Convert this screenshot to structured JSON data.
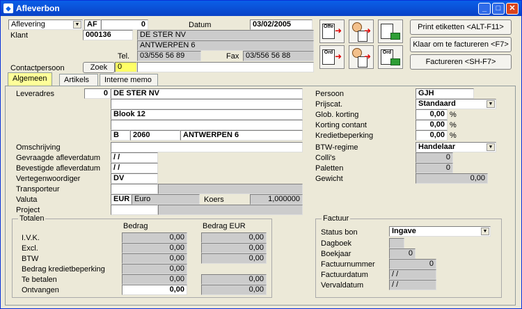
{
  "window": {
    "title": "Afleverbon",
    "minimize": "_",
    "maximize": "□",
    "close": "✕"
  },
  "header": {
    "doc_type": "Aflevering",
    "code": "AF",
    "number": "0",
    "date_label": "Datum",
    "date": "03/02/2005",
    "klant_label": "Klant",
    "klant_nr": "000136",
    "klant_name": "DE STER NV",
    "klant_city": "ANTWERPEN 6",
    "tel_label": "Tel.",
    "tel": "03/556 56 89",
    "fax_label": "Fax",
    "fax": "03/556 56 88",
    "contact_label": "Contactpersoon",
    "zoek_label": "Zoek",
    "contact_value": "0"
  },
  "icon_buttons": [
    {
      "text": "Offe"
    },
    {
      "text": "Ord"
    },
    {
      "text": "Ord"
    }
  ],
  "actions": {
    "print": "Print etiketten <ALT-F11>",
    "klaar": "Klaar om te factureren <F7>",
    "factureren": "Factureren <SH-F7>"
  },
  "tabs": [
    "Algemeen",
    "Artikels",
    "Interne memo"
  ],
  "left": {
    "leveradres_label": "Leveradres",
    "leveradres_nr": "0",
    "leveradres_name": "DE STER NV",
    "address_line3": "Blook 12",
    "country": "B",
    "postcode": "2060",
    "city": "ANTWERPEN 6",
    "omschrijving_label": "Omschrijving",
    "gevraagde_label": "Gevraagde afleverdatum",
    "gevraagde": " /  /",
    "bevestigde_label": "Bevestigde afleverdatum",
    "bevestigde": " /  /",
    "vertegen_label": "Vertegenwoordiger",
    "vertegen": "DV",
    "transporteur_label": "Transporteur",
    "valuta_label": "Valuta",
    "valuta_code": "EUR",
    "valuta_name": "Euro",
    "koers_label": "Koers",
    "koers": "1,000000",
    "project_label": "Project"
  },
  "right": {
    "persoon_label": "Persoon",
    "persoon": "GJH",
    "prijscat_label": "Prijscat.",
    "prijscat": "Standaard",
    "glob_label": "Glob. korting",
    "glob": "0,00",
    "kortcont_label": "Korting contant",
    "kortcont": "0,00",
    "kredietbep_label": "Kredietbeperking",
    "kredietbep": "0,00",
    "pct": "%",
    "btw_label": "BTW-regime",
    "btw": "Handelaar",
    "collis_label": "Colli's",
    "collis": "0",
    "paletten_label": "Paletten",
    "paletten": "0",
    "gewicht_label": "Gewicht",
    "gewicht": "0,00"
  },
  "totalen": {
    "title": "Totalen",
    "col1": "Bedrag",
    "col2": "Bedrag EUR",
    "rows": [
      {
        "label": "I.V.K.",
        "v1": "0,00",
        "v2": "0,00"
      },
      {
        "label": "Excl.",
        "v1": "0,00",
        "v2": "0,00"
      },
      {
        "label": "BTW",
        "v1": "0,00",
        "v2": "0,00"
      },
      {
        "label": "Bedrag kredietbeperking",
        "v1": "0,00",
        "v2": ""
      },
      {
        "label": "Te betalen",
        "v1": "0,00",
        "v2": "0,00"
      },
      {
        "label": "Ontvangen",
        "v1": "0,00",
        "v2": "0,00"
      }
    ]
  },
  "factuur": {
    "title": "Factuur",
    "status_label": "Status bon",
    "status": "Ingave",
    "dagboek_label": "Dagboek",
    "dagboek": "",
    "boekjaar_label": "Boekjaar",
    "boekjaar": "0",
    "factuurnr_label": "Factuurnummer",
    "factuurnr": "0",
    "factuurdatum_label": "Factuurdatum",
    "factuurdatum": " /  /",
    "vervaldatum_label": "Vervaldatum",
    "vervaldatum": " /  /"
  }
}
